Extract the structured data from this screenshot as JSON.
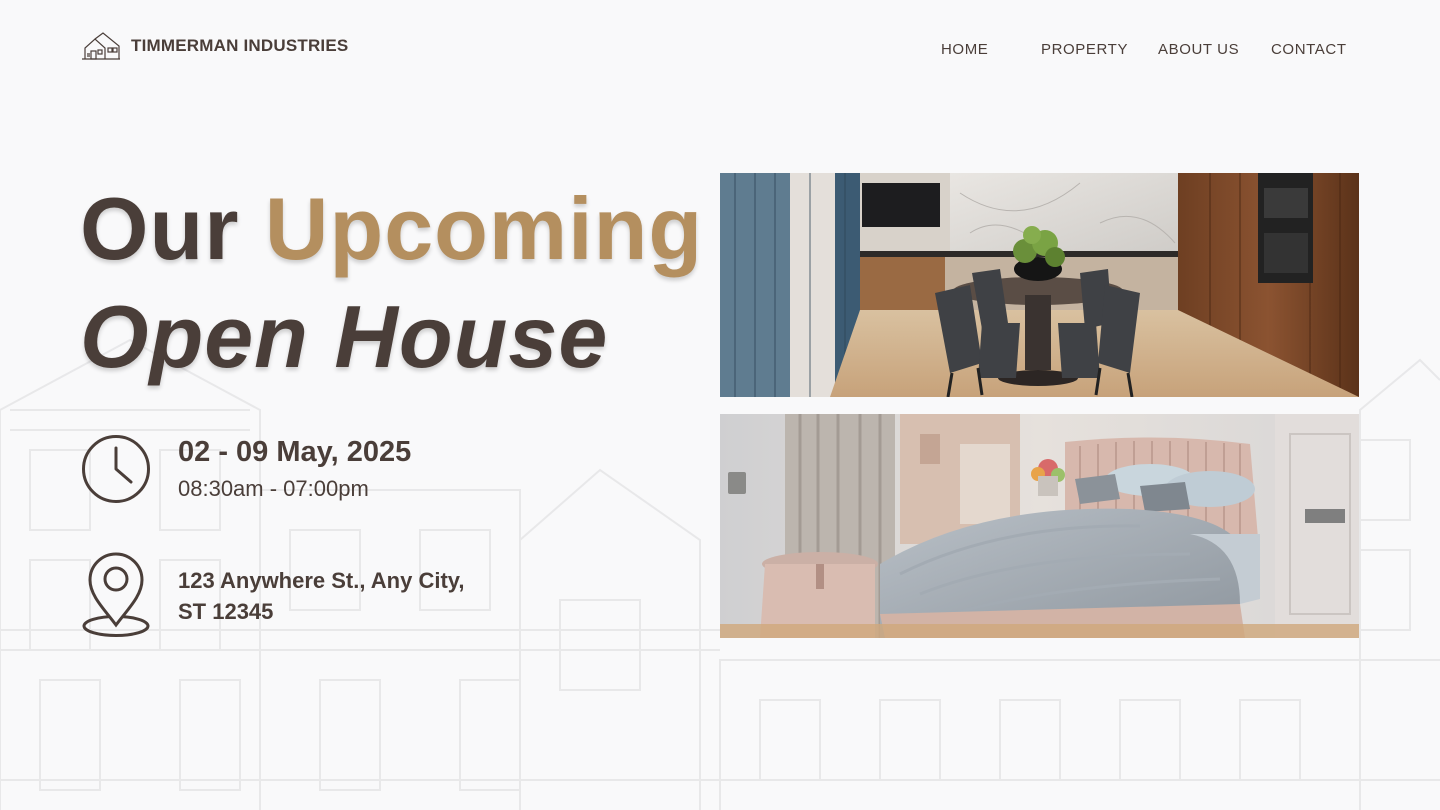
{
  "brand": {
    "name": "TIMMERMAN INDUSTRIES",
    "logo_icon": "house-outline-icon"
  },
  "nav": {
    "items": [
      {
        "label": "HOME"
      },
      {
        "label": "PROPERTY"
      },
      {
        "label": "ABOUT US"
      },
      {
        "label": "CONTACT"
      }
    ]
  },
  "hero": {
    "title_word1": "Our",
    "title_word2": "Upcoming",
    "title_line2": "Open House"
  },
  "schedule": {
    "date": "02 - 09 May, 2025",
    "hours": "08:30am - 07:00pm",
    "icon": "clock-icon"
  },
  "location": {
    "address": "123 Anywhere St., Any City,\nST 12345",
    "icon": "location-pin-icon"
  },
  "photos": [
    {
      "subject": "dining-kitchen-photo"
    },
    {
      "subject": "bedroom-photo"
    }
  ],
  "colors": {
    "primary_text": "#4a3e39",
    "accent_gold": "#b48f5f",
    "background": "#f9f9fa"
  }
}
